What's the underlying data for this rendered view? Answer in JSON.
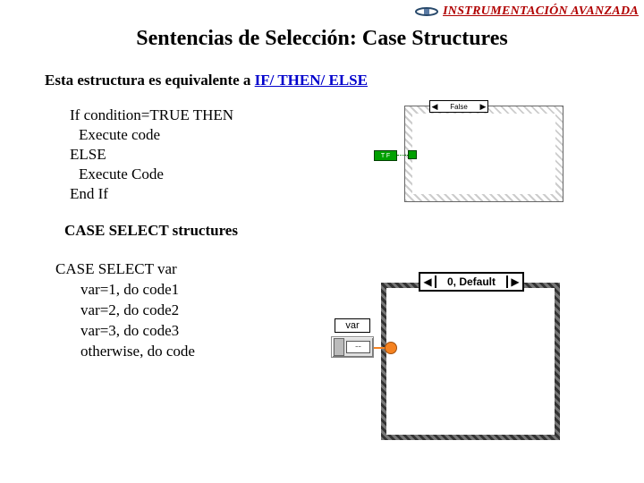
{
  "header": {
    "brand": "INSTRUMENTACIÓN AVANZADA"
  },
  "title": "Sentencias de Selección: Case Structures",
  "intro": {
    "prefix": "Esta estructura es equivalente a ",
    "link": "IF/ THEN/ ELSE"
  },
  "pseudo_if": {
    "l1": "If condition=TRUE THEN",
    "l2": "Execute code",
    "l3": "ELSE",
    "l4": "Execute Code",
    "l5": "End If"
  },
  "subheading": "CASE SELECT structures",
  "pseudo_case": {
    "l1": "CASE SELECT var",
    "l2": "var=1, do code1",
    "l3": "var=2, do code2",
    "l4": "var=3, do code3",
    "l5": "otherwise, do code"
  },
  "diagram1": {
    "selector_label": "False",
    "terminal_label": "T F"
  },
  "diagram2": {
    "selector_label": "0, Default",
    "var_label": "var",
    "var_value": "--"
  }
}
